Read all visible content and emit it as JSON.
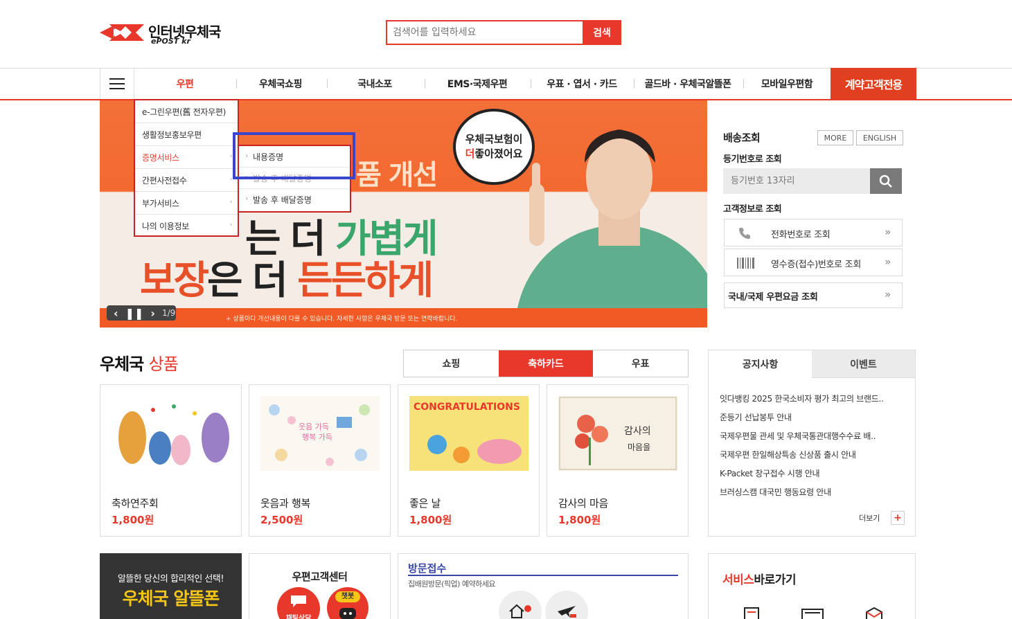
{
  "header": {
    "logo_name": "인터넷우체국",
    "logo_sub": "ePOST kr",
    "search_placeholder": "검색어를 입력하세요",
    "search_button": "검색"
  },
  "gnb": {
    "items": [
      "우편",
      "우체국쇼핑",
      "국내소포",
      "EMS·국제우편",
      "우표 · 엽서 · 카드",
      "골드바 · 우체국알뜰폰",
      "모바일우편함"
    ],
    "contract": "계약고객전용",
    "active_color": "#e8382b"
  },
  "dropdown": {
    "items": [
      "e-그린우편(舊 전자우편)",
      "생활정보홍보우편",
      "증명서비스",
      "간편사전접수",
      "부가서비스",
      "나의 이용정보"
    ],
    "active_index": 2,
    "submenu": [
      "내용증명",
      "발송 후 배달증명",
      "발송 후 배달증명"
    ]
  },
  "banner": {
    "bubble_line1": "우체국보험이",
    "bubble_em": "더",
    "bubble_line2": "좋아졌어요",
    "top_text": "품 개선",
    "line1_prefix": "는 더 ",
    "line1_em": "가볍게",
    "line2_prefix": "보장",
    "line2_mid": "은 더 ",
    "line2_em": "든든하게",
    "note": "+ 상품마다 개선내용이 다를 수 있습니다. 자세한 사항은 우체국 방문 또는 연락바랍니다.",
    "page": "1/9"
  },
  "tracking": {
    "title": "배송조회",
    "more": "MORE",
    "english": "ENGLISH",
    "reg_title": "등기번호로 조회",
    "reg_placeholder": "등기번호 13자리",
    "cust_title": "고객정보로 조회",
    "phone_lookup": "전화번호로 조회",
    "receipt_lookup": "영수증(접수)번호로 조회",
    "rate_lookup": "국내/국제 우편요금 조회"
  },
  "products": {
    "title_main": "우체국",
    "title_em": "상품",
    "tabs": [
      "쇼핑",
      "축하카드",
      "우표"
    ],
    "active_tab": 1,
    "cards": [
      {
        "name": "축하연주회",
        "price": "1,800원"
      },
      {
        "name": "웃음과 행복",
        "price": "2,500원"
      },
      {
        "name": "좋은 날",
        "price": "1,800원"
      },
      {
        "name": "감사의 마음",
        "price": "1,800원"
      }
    ]
  },
  "notice": {
    "tabs": [
      "공지사항",
      "이벤트"
    ],
    "items": [
      "잇다뱅킹 2025 한국소비자 평가 최고의 브랜드..",
      "준등기 선납봉투 안내",
      "국제우편물 관세 및 우체국통관대행수수료 배..",
      "국제우편 한일해상특송 신상품 출시 안내",
      "K-Packet 창구접수 시행 안내",
      "브러싱스캠 대국민 행동요령 안내"
    ],
    "more": "더보기"
  },
  "bottom": {
    "phone_l1": "알뜰한 당신의 합리적인 선택!",
    "phone_l2": "우체국 알뜰폰",
    "cc_title": "우편고객센터",
    "cc_chat1": "채팅상담",
    "cc_chat2": "챗봇",
    "visit_title": "방문접수",
    "visit_sub": "집배원방문(픽업) 예약하세요",
    "svc_title_em": "서비스",
    "svc_title": "바로가기"
  }
}
